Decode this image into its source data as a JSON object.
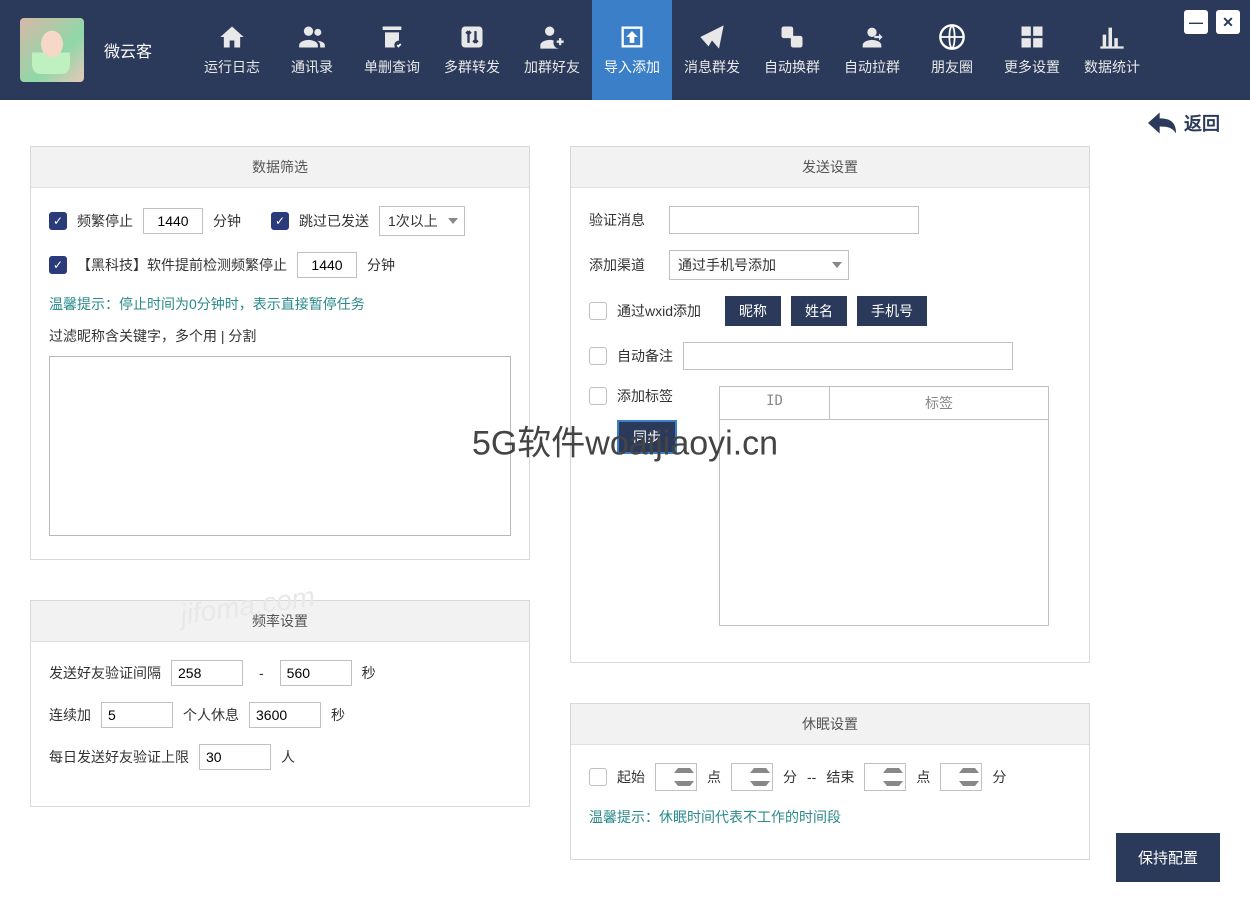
{
  "app": {
    "name": "微云客"
  },
  "nav": {
    "items": [
      {
        "label": "运行日志",
        "icon": "home"
      },
      {
        "label": "通讯录",
        "icon": "contacts"
      },
      {
        "label": "单删查询",
        "icon": "delete-query"
      },
      {
        "label": "多群转发",
        "icon": "forward"
      },
      {
        "label": "加群好友",
        "icon": "add-friend"
      },
      {
        "label": "导入添加",
        "icon": "import",
        "active": true
      },
      {
        "label": "消息群发",
        "icon": "send"
      },
      {
        "label": "自动换群",
        "icon": "swap"
      },
      {
        "label": "自动拉群",
        "icon": "pull-group"
      },
      {
        "label": "朋友圈",
        "icon": "moments"
      },
      {
        "label": "更多设置",
        "icon": "grid"
      },
      {
        "label": "数据统计",
        "icon": "stats"
      }
    ]
  },
  "back_label": "返回",
  "panels": {
    "filter": {
      "title": "数据筛选",
      "freq_stop_label": "频繁停止",
      "freq_stop_value": "1440",
      "freq_stop_unit": "分钟",
      "skip_sent_label": "跳过已发送",
      "skip_sent_select": "1次以上",
      "blacktech_label": "【黑科技】软件提前检测频繁停止",
      "blacktech_value": "1440",
      "blacktech_unit": "分钟",
      "tip_prefix": "温馨提示：",
      "tip_text": "停止时间为0分钟时，表示直接暂停任务",
      "filter_nick_label": "过滤昵称含关键字，多个用 | 分割",
      "filter_nick_value": ""
    },
    "freq": {
      "title": "频率设置",
      "interval_label": "发送好友验证间隔",
      "interval_min": "258",
      "interval_max": "560",
      "interval_unit": "秒",
      "continuous_prefix": "连续加",
      "continuous_value": "5",
      "continuous_mid": "个人休息",
      "rest_value": "3600",
      "rest_unit": "秒",
      "daily_limit_label": "每日发送好友验证上限",
      "daily_limit_value": "30",
      "daily_limit_unit": "人"
    },
    "send": {
      "title": "发送设置",
      "verify_msg_label": "验证消息",
      "verify_msg_value": "",
      "channel_label": "添加渠道",
      "channel_value": "通过手机号添加",
      "via_wxid_label": "通过wxid添加",
      "btn_nick": "昵称",
      "btn_name": "姓名",
      "btn_phone": "手机号",
      "auto_remark_label": "自动备注",
      "auto_remark_value": "",
      "add_tag_label": "添加标签",
      "sync_btn": "同步",
      "table_col1": "ID",
      "table_col2": "标签"
    },
    "sleep": {
      "title": "休眠设置",
      "start_label": "起始",
      "hour_unit": "点",
      "minute_unit": "分",
      "sep": "--",
      "end_label": "结束",
      "tip_prefix": "温馨提示：",
      "tip_text": "休眠时间代表不工作的时间段"
    }
  },
  "save_btn": "保持配置",
  "watermark": "5G软件woaijiaoyi.cn",
  "watermark2": "jifoma.com"
}
